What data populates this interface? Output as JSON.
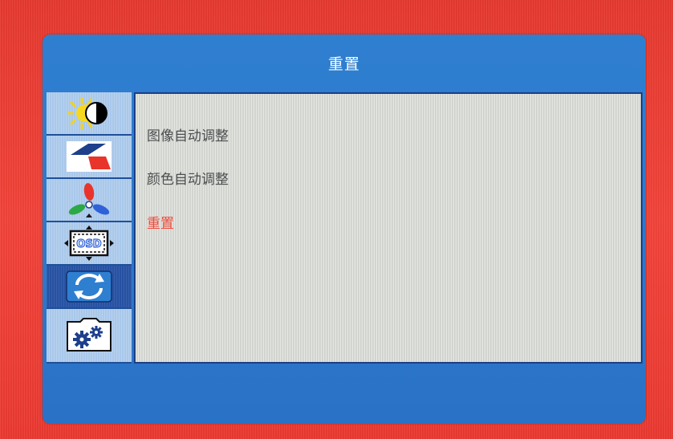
{
  "osd": {
    "title": "重置"
  },
  "sidebar": {
    "items": [
      {
        "icon": "brightness-contrast-icon",
        "active": false
      },
      {
        "icon": "image-adjust-icon",
        "active": false
      },
      {
        "icon": "color-settings-icon",
        "active": false
      },
      {
        "icon": "osd-settings-icon",
        "active": false
      },
      {
        "icon": "reset-icon",
        "active": true
      },
      {
        "icon": "system-settings-icon",
        "active": false
      }
    ]
  },
  "menu": {
    "items": [
      {
        "label": "图像自动调整",
        "selected": false
      },
      {
        "label": "颜色自动调整",
        "selected": false
      },
      {
        "label": "重置",
        "selected": true
      }
    ]
  },
  "colors": {
    "background": "#f03a32",
    "panel_blue": "#2f7fd1",
    "selected_text": "#f14a3a",
    "normal_text": "#4b4f4f",
    "content_bg": "#d9dbd6"
  }
}
